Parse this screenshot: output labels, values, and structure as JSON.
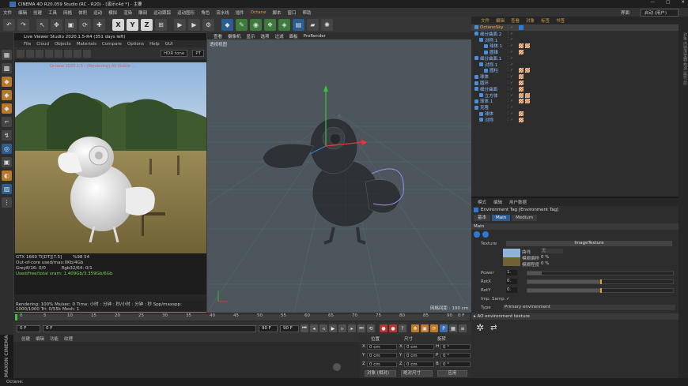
{
  "window": {
    "title": "CINEMA 4D R20.059 Studio (RC - R20) - [演示c4d *] - 主要"
  },
  "menu": {
    "items": [
      "文件",
      "编辑",
      "创建",
      "工具",
      "网格",
      "体积",
      "运动",
      "模拟",
      "渲染",
      "雕刻",
      "运动跟踪",
      "运动图形",
      "角色",
      "流水线",
      "插件",
      "Octane",
      "脚本",
      "窗口",
      "帮助"
    ],
    "right_label": "界面",
    "layout_value": "启动 (用户)"
  },
  "octane": {
    "title": "Live Viewer Studio 2020.1.5-R4 (351 days left)",
    "menu": [
      "File",
      "Cloud",
      "Objects",
      "Materials",
      "Compare",
      "Options",
      "Help",
      "GUI"
    ],
    "tonemap": "HDR tone",
    "mode": "PT",
    "overlay": "Octane 2020.1.5 - (Rendering) All Visible ...",
    "stats": [
      {
        "l": "GTX 1660 Ti[DT][7.5]",
        "r": "%98    54"
      },
      {
        "l": "Out-of-core used/max:0Kb/4Gb",
        "r": ""
      },
      {
        "l": "Grey8/16: 0/0",
        "r": "Rgb32/64: 0/1"
      },
      {
        "l": "Used/free/total vram: 1.409Gb/3.359Gb/6Gb",
        "r": ""
      }
    ],
    "status": "Rendering: 100%   Ms/sec: 0   Time: 小时 : 分钟 : 秒/小时 : 分钟 : 秒   Spp/maxspp: 1000/1000   Tri: 0/55k   Mesh: 1"
  },
  "viewport": {
    "menu": [
      "查看",
      "摄像机",
      "显示",
      "选项",
      "过滤",
      "面板",
      "ProRender"
    ],
    "label": "透视视图",
    "scale": "网格间距 : 100 cm"
  },
  "timeline": {
    "ticks": [
      "0",
      "5",
      "10",
      "15",
      "20",
      "25",
      "30",
      "35",
      "40",
      "45",
      "50",
      "55",
      "60",
      "65",
      "70",
      "75",
      "80",
      "85",
      "90"
    ],
    "tick_end": "0 F",
    "start": "0 F",
    "current": "0 F",
    "end": "90 F",
    "end2": "90 F"
  },
  "material": {
    "menu": [
      "创建",
      "编辑",
      "功能",
      "纹理"
    ]
  },
  "coords": {
    "headers": [
      "位置",
      "尺寸",
      "旋转"
    ],
    "rows": [
      {
        "axis": "X",
        "pos": "0 cm",
        "size": "0 cm",
        "rl": "H",
        "rot": "0 °"
      },
      {
        "axis": "Y",
        "pos": "0 cm",
        "size": "0 cm",
        "rl": "P",
        "rot": "0 °"
      },
      {
        "axis": "Z",
        "pos": "0 cm",
        "size": "0 cm",
        "rl": "B",
        "rot": "0 °"
      }
    ],
    "mode1": "对象 (相对)",
    "mode2": "绝对尺寸",
    "apply": "应用"
  },
  "objects": {
    "tabs": [
      "文件",
      "编辑",
      "查看",
      "对象",
      "标签",
      "书签"
    ],
    "rows": [
      {
        "indent": 0,
        "name": "OctaneSky",
        "sel": true,
        "tags": [
          "oc"
        ]
      },
      {
        "indent": 0,
        "name": "细分曲面.2",
        "tags": []
      },
      {
        "indent": 1,
        "name": "对称.1",
        "tags": []
      },
      {
        "indent": 2,
        "name": "球体.1",
        "tags": [
          "ck",
          "ck"
        ]
      },
      {
        "indent": 2,
        "name": "圆锥",
        "tags": [
          "ck"
        ]
      },
      {
        "indent": 0,
        "name": "细分曲面.1",
        "tags": []
      },
      {
        "indent": 1,
        "name": "对称.1",
        "tags": []
      },
      {
        "indent": 2,
        "name": "圆柱",
        "tags": [
          "ck",
          "ck"
        ]
      },
      {
        "indent": 0,
        "name": "球体",
        "tags": [
          "ck"
        ]
      },
      {
        "indent": 0,
        "name": "圆环",
        "tags": [
          "ck"
        ]
      },
      {
        "indent": 0,
        "name": "细分曲面",
        "tags": [
          "ck"
        ]
      },
      {
        "indent": 1,
        "name": "立方体",
        "tags": [
          "ck",
          "ck"
        ]
      },
      {
        "indent": 0,
        "name": "球体.1",
        "tags": [
          "ck",
          "ck"
        ]
      },
      {
        "indent": 0,
        "name": "克隆",
        "tags": []
      },
      {
        "indent": 1,
        "name": "球体",
        "tags": [
          "ck"
        ]
      },
      {
        "indent": 1,
        "name": "对称",
        "tags": [
          "ck"
        ]
      }
    ]
  },
  "attributes": {
    "tabs": [
      "模式",
      "编辑",
      "用户数据"
    ],
    "title": "Environment Tag [Environment Tag]",
    "subtabs": [
      "基本",
      "Main",
      "Medium"
    ],
    "section": "Main",
    "texture_label": "Texture",
    "texture_value": "ImageTexture",
    "sub_rows": [
      {
        "l": "曲线",
        "v": "无"
      },
      {
        "l": "模糊偏移",
        "v": "0 %"
      },
      {
        "l": "模糊程度",
        "v": "0 %"
      }
    ],
    "params": [
      {
        "l": "Power",
        "v": "1.",
        "fill": 0.1
      },
      {
        "l": "RotX",
        "v": "0.",
        "fill": 0.5
      },
      {
        "l": "RotY",
        "v": "0.",
        "fill": 0.5
      }
    ],
    "imp_label": "Imp. Samp.",
    "imp_value": "✓",
    "type_label": "Type",
    "type_value": "Primary environment",
    "bottom": "▸ AO environment texture"
  },
  "right_strip": "对象 内容浏览器 构造 属性 层",
  "status": "Octane:",
  "brand": "MAXON CINEMA 4D"
}
